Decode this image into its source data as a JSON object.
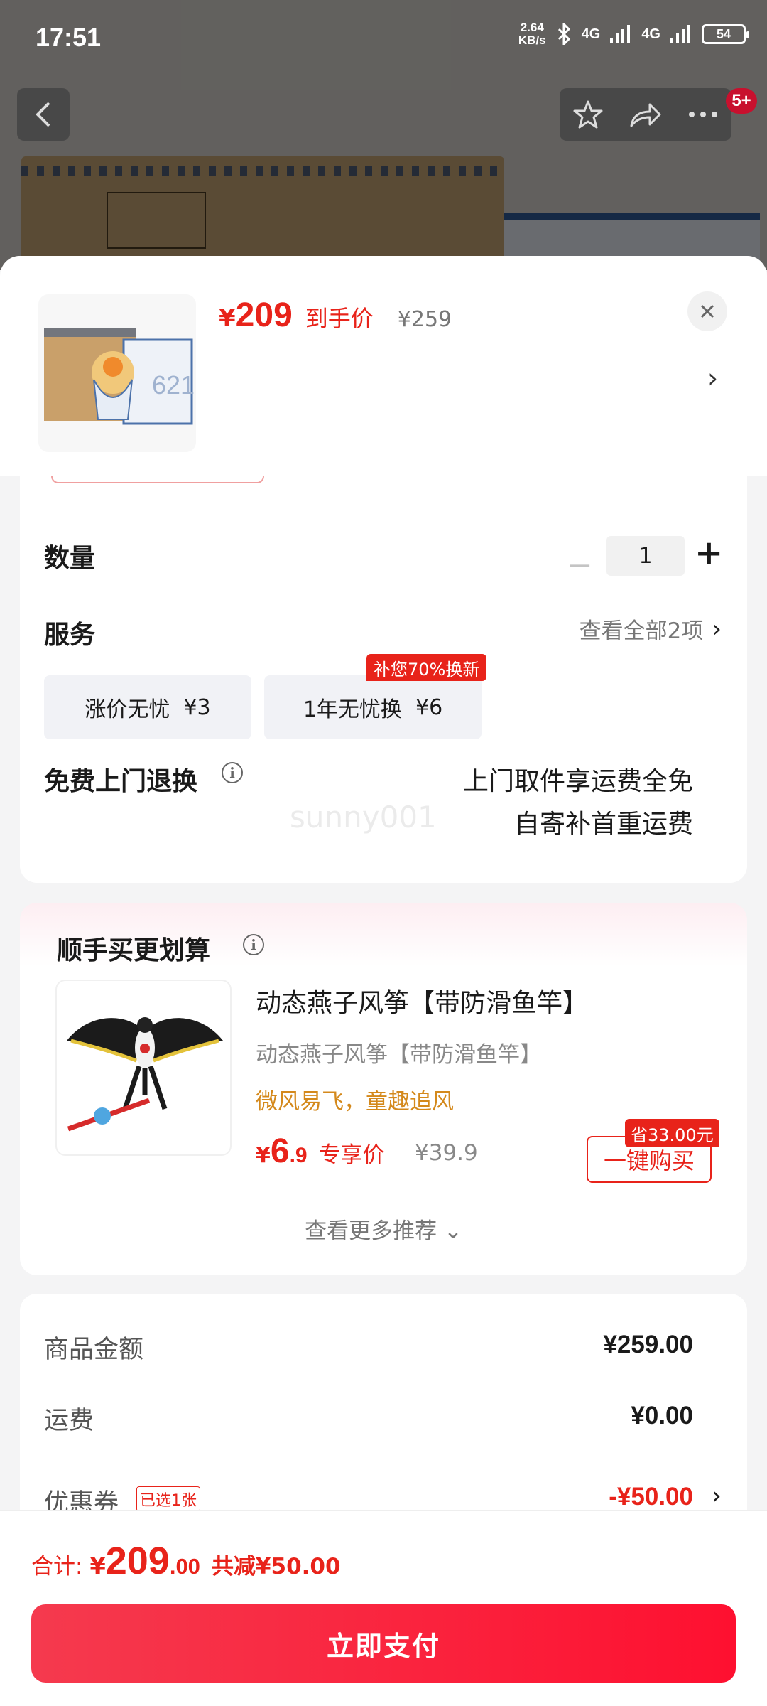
{
  "status_bar": {
    "time": "17:51",
    "net_speed_value": "2.64",
    "net_speed_unit": "KB/s",
    "signal_1": "4G",
    "signal_2": "4G",
    "battery": "54"
  },
  "top_nav": {
    "notification_badge": "5+"
  },
  "product": {
    "price_currency": "¥",
    "price_value": "209",
    "price_tag": "到手价",
    "original_price": "¥259"
  },
  "quantity": {
    "label": "数量",
    "minus": "−",
    "value": "1",
    "plus": "+"
  },
  "service": {
    "label": "服务",
    "view_all": "查看全部2项",
    "options": [
      {
        "name": "涨价无忧",
        "price": "¥3"
      },
      {
        "name": "1年无忧换",
        "price": "¥6",
        "badge": "补您70%换新"
      }
    ]
  },
  "free_return": {
    "label": "免费上门退换",
    "line1": "上门取件享运费全免",
    "line2": "自寄补首重运费"
  },
  "watermark": "sunny001",
  "recommend": {
    "title": "顺手买更划算",
    "item": {
      "name": "动态燕子风筝【带防滑鱼竿】",
      "subtitle": "动态燕子风筝【带防滑鱼竿】",
      "slogan": "微风易飞，童趣追风",
      "price_currency": "¥",
      "price_int": "6",
      "price_dec": ".9",
      "price_tag": "专享价",
      "original_price": "¥39.9",
      "save_badge": "省33.00元",
      "buy_label": "一键购买"
    },
    "more": "查看更多推荐"
  },
  "price_details": {
    "goods_label": "商品金额",
    "goods_value": "¥259.00",
    "shipping_label": "运费",
    "shipping_value": "¥0.00",
    "coupon_label": "优惠券",
    "coupon_badge": "已选1张",
    "coupon_value": "-¥50.00"
  },
  "bottom": {
    "total_label": "合计:",
    "total_currency": "¥",
    "total_int": "209",
    "total_dec": ".00",
    "discount": "共减¥50.00",
    "pay_label": "立即支付"
  },
  "colors": {
    "accent_red": "#e8231a",
    "pay_button": "#fe1030",
    "slogan_orange": "#d4891c"
  }
}
